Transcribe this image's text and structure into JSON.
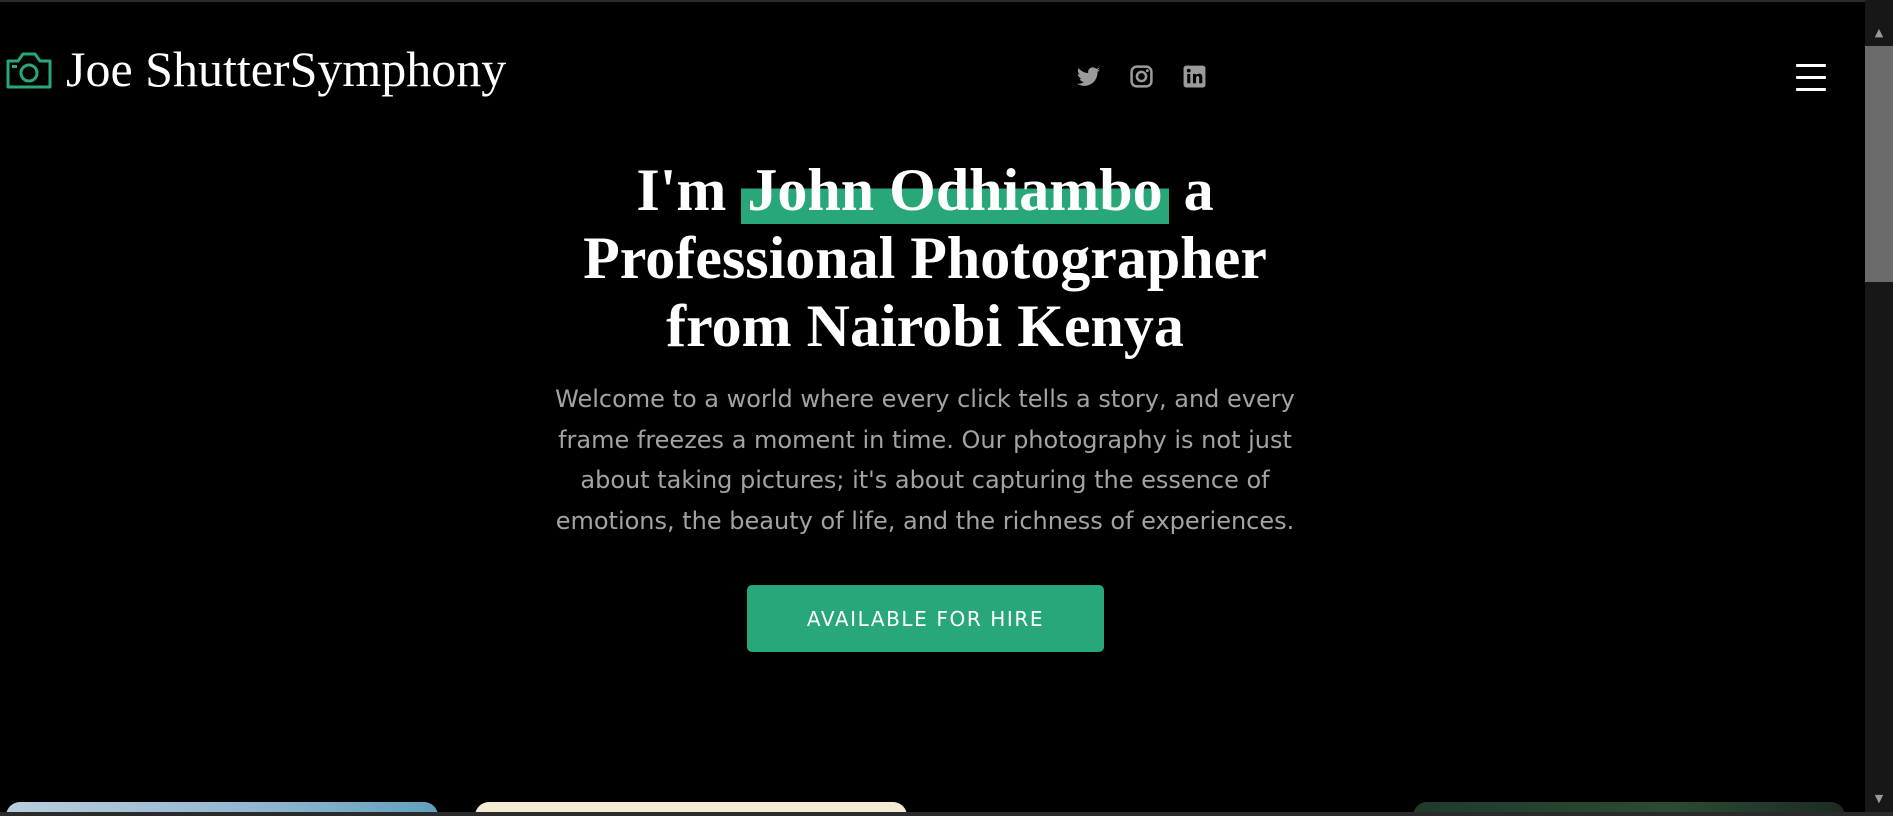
{
  "header": {
    "brand_name": "Joe ShutterSymphony",
    "brand_icon": "camera-icon",
    "social_icons": [
      "twitter-icon",
      "instagram-icon",
      "linkedin-icon"
    ],
    "menu_icon": "hamburger-menu-icon"
  },
  "hero": {
    "title_prefix": "I'm ",
    "title_highlight": "John Odhiambo",
    "title_line1_suffix": " a",
    "title_line2": "Professional Photographer",
    "title_line3": "from Nairobi Kenya",
    "description": "Welcome to a world where every click tells a story, and every frame freezes a moment in time. Our photography is not just about taking pictures; it's about capturing the essence of emotions, the beauty of life, and the richness of experiences.",
    "cta_label": "AVAILABLE FOR HIRE"
  },
  "scrollbar": {
    "up_arrow": "▲",
    "down_arrow": "▼"
  },
  "colors": {
    "background": "#000000",
    "accent": "#28a878",
    "text": "#ffffff",
    "muted_text": "#a3a3a3",
    "icon_gray": "#9b9b9b"
  }
}
